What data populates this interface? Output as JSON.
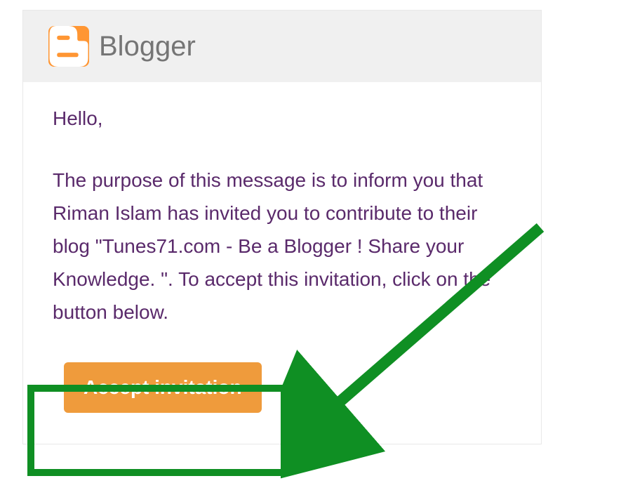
{
  "header": {
    "service_name": "Blogger",
    "icon_name": "blogger-icon"
  },
  "body": {
    "greeting": "Hello,",
    "message": "The purpose of this message is to inform you that Riman Islam has invited you to contribute to their blog \"Tunes71.com - Be a Blogger ! Share your Knowledge. \". To accept this invitation, click on the button below."
  },
  "actions": {
    "accept_label": "Accept invitation"
  },
  "annotation": {
    "highlight_color": "#0f8f23"
  }
}
